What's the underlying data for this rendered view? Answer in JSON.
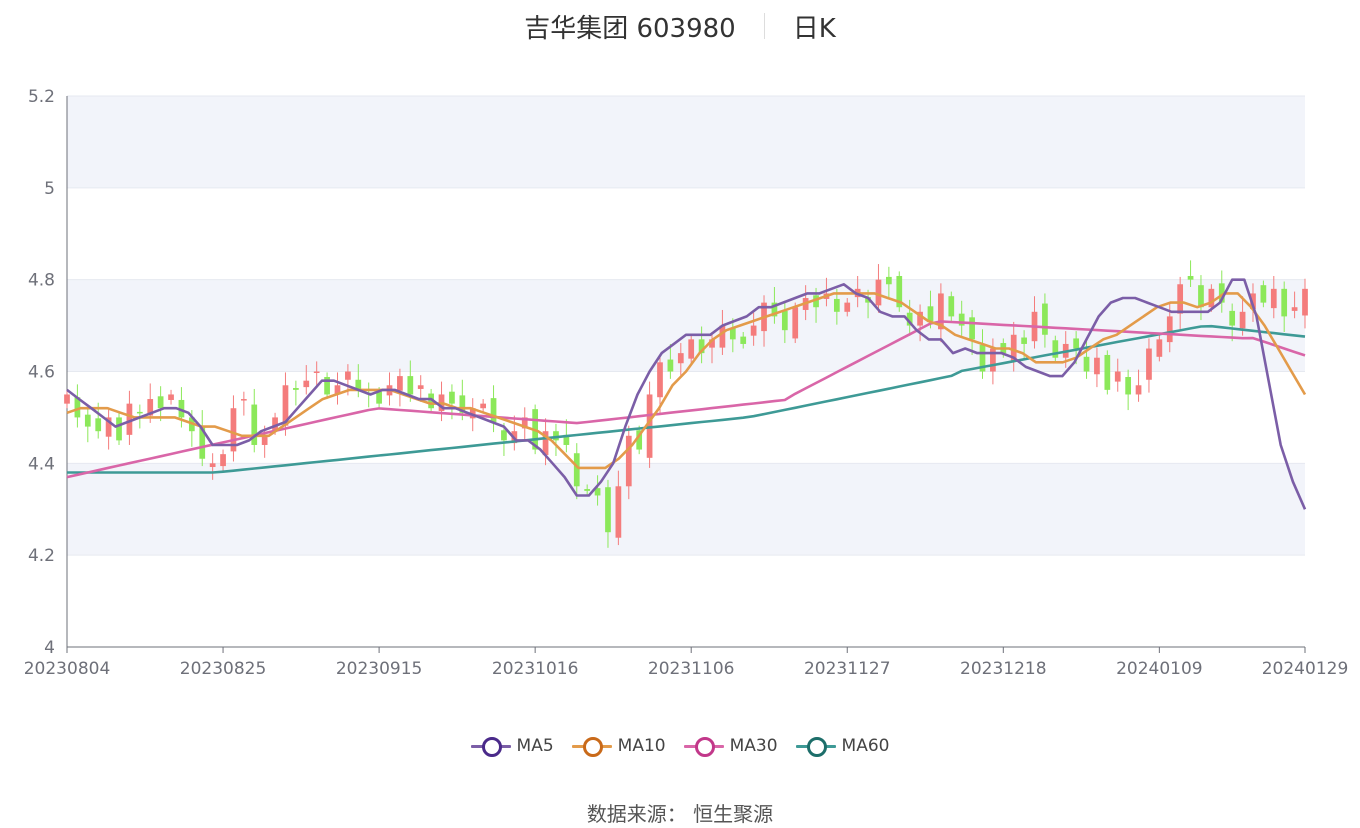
{
  "header": {
    "title": "吉华集团 603980",
    "period": "日K"
  },
  "source": {
    "label": "数据来源：",
    "name": "恒生聚源"
  },
  "colors": {
    "up": "#f47c7c",
    "down": "#8ce85a",
    "grid": "#e6e9f0",
    "band": "#f2f4fa",
    "axis": "#6e7079"
  },
  "chart_data": {
    "type": "candlestick",
    "ylim": [
      4,
      5.2
    ],
    "y_ticks": [
      "4",
      "4.2",
      "4.4",
      "4.6",
      "4.8",
      "5",
      "5.2"
    ],
    "x_ticks": [
      "20230804",
      "20230825",
      "20230915",
      "20231016",
      "20231106",
      "20231127",
      "20231218",
      "20240109",
      "20240129"
    ],
    "x_tick_days": [
      0,
      15,
      30,
      45,
      60,
      75,
      90,
      105,
      119
    ],
    "legend": [
      {
        "name": "MA5",
        "color": "#7b5ea7",
        "ring": "#4a2a8a"
      },
      {
        "name": "MA10",
        "color": "#e39b4a",
        "ring": "#c96a1a"
      },
      {
        "name": "MA30",
        "color": "#d966a8",
        "ring": "#c2388a"
      },
      {
        "name": "MA60",
        "color": "#3e9a96",
        "ring": "#1d6e6a"
      }
    ],
    "closes": [
      4.55,
      4.5,
      4.48,
      4.47,
      4.5,
      4.45,
      4.53,
      4.51,
      4.54,
      4.52,
      4.55,
      4.5,
      4.47,
      4.41,
      4.4,
      4.42,
      4.52,
      4.54,
      4.44,
      4.46,
      4.5,
      4.57,
      4.56,
      4.58,
      4.6,
      4.55,
      4.57,
      4.6,
      4.56,
      4.55,
      4.53,
      4.57,
      4.59,
      4.55,
      4.57,
      4.52,
      4.55,
      4.53,
      4.51,
      4.52,
      4.53,
      4.49,
      4.45,
      4.47,
      4.5,
      4.43,
      4.47,
      4.45,
      4.44,
      4.35,
      4.34,
      4.33,
      4.25,
      4.35,
      4.46,
      4.43,
      4.55,
      4.62,
      4.6,
      4.64,
      4.67,
      4.64,
      4.67,
      4.7,
      4.67,
      4.66,
      4.7,
      4.75,
      4.72,
      4.69,
      4.74,
      4.76,
      4.74,
      4.77,
      4.73,
      4.75,
      4.78,
      4.75,
      4.8,
      4.79,
      4.74,
      4.7,
      4.73,
      4.71,
      4.77,
      4.72,
      4.7,
      4.67,
      4.6,
      4.65,
      4.64,
      4.68,
      4.66,
      4.73,
      4.68,
      4.63,
      4.66,
      4.65,
      4.6,
      4.63,
      4.56,
      4.6,
      4.55,
      4.57,
      4.65,
      4.67,
      4.72,
      4.79,
      4.8,
      4.74,
      4.78,
      4.75,
      4.7,
      4.73,
      4.77,
      4.75,
      4.78,
      4.72,
      4.74,
      4.78
    ],
    "ma5": [
      4.56,
      4.54,
      4.52,
      4.5,
      4.48,
      4.49,
      4.5,
      4.51,
      4.52,
      4.52,
      4.51,
      4.48,
      4.44,
      4.44,
      4.44,
      4.45,
      4.47,
      4.48,
      4.49,
      4.52,
      4.55,
      4.58,
      4.58,
      4.57,
      4.56,
      4.55,
      4.56,
      4.56,
      4.55,
      4.54,
      4.54,
      4.52,
      4.52,
      4.51,
      4.5,
      4.49,
      4.48,
      4.45,
      4.45,
      4.43,
      4.4,
      4.37,
      4.33,
      4.33,
      4.36,
      4.4,
      4.48,
      4.55,
      4.6,
      4.64,
      4.66,
      4.68,
      4.68,
      4.68,
      4.7,
      4.71,
      4.72,
      4.74,
      4.74,
      4.75,
      4.76,
      4.77,
      4.77,
      4.78,
      4.79,
      4.77,
      4.76,
      4.73,
      4.72,
      4.72,
      4.69,
      4.67,
      4.67,
      4.64,
      4.65,
      4.64,
      4.64,
      4.64,
      4.63,
      4.61,
      4.6,
      4.59,
      4.59,
      4.62,
      4.67,
      4.72,
      4.75,
      4.76,
      4.76,
      4.75,
      4.74,
      4.73,
      4.73,
      4.73,
      4.73,
      4.75,
      4.8,
      4.8,
      4.72,
      4.58,
      4.44,
      4.36,
      4.3
    ],
    "ma5_days": [
      0,
      2,
      4,
      6,
      8,
      10,
      12,
      14,
      16,
      18,
      20,
      22,
      24,
      26,
      28,
      30,
      32,
      34,
      36,
      38,
      40,
      42,
      44,
      46,
      48,
      50,
      52,
      54,
      56,
      58,
      60,
      62,
      64,
      66,
      68,
      70,
      72,
      74,
      76,
      78,
      80,
      82,
      84,
      86,
      88,
      90,
      92,
      94,
      96,
      98,
      100,
      102,
      104,
      106,
      108,
      110,
      112,
      114,
      116,
      118,
      120,
      122,
      124,
      126,
      128,
      130,
      132,
      134,
      136,
      138,
      140,
      142,
      144,
      146,
      148,
      150,
      152,
      154,
      156,
      158,
      160,
      162,
      164,
      166,
      168,
      170,
      172,
      174,
      176,
      178,
      180,
      182,
      184,
      186,
      188,
      190,
      192,
      194,
      196,
      198,
      200,
      202,
      204
    ],
    "ma10": [
      4.51,
      4.52,
      4.52,
      4.52,
      4.51,
      4.5,
      4.5,
      4.5,
      4.5,
      4.49,
      4.48,
      4.48,
      4.47,
      4.46,
      4.46,
      4.46,
      4.48,
      4.5,
      4.52,
      4.54,
      4.55,
      4.56,
      4.56,
      4.56,
      4.56,
      4.55,
      4.54,
      4.53,
      4.53,
      4.52,
      4.52,
      4.51,
      4.5,
      4.49,
      4.48,
      4.47,
      4.45,
      4.42,
      4.39,
      4.39,
      4.39,
      4.41,
      4.44,
      4.48,
      4.52,
      4.57,
      4.6,
      4.64,
      4.67,
      4.69,
      4.7,
      4.71,
      4.72,
      4.73,
      4.74,
      4.75,
      4.76,
      4.77,
      4.77,
      4.77,
      4.77,
      4.76,
      4.75,
      4.73,
      4.71,
      4.7,
      4.68,
      4.67,
      4.66,
      4.65,
      4.65,
      4.64,
      4.62,
      4.62,
      4.62,
      4.63,
      4.65,
      4.67,
      4.68,
      4.7,
      4.72,
      4.74,
      4.75,
      4.75,
      4.74,
      4.75,
      4.77,
      4.77,
      4.74,
      4.7,
      4.65,
      4.6,
      4.55
    ]
  }
}
